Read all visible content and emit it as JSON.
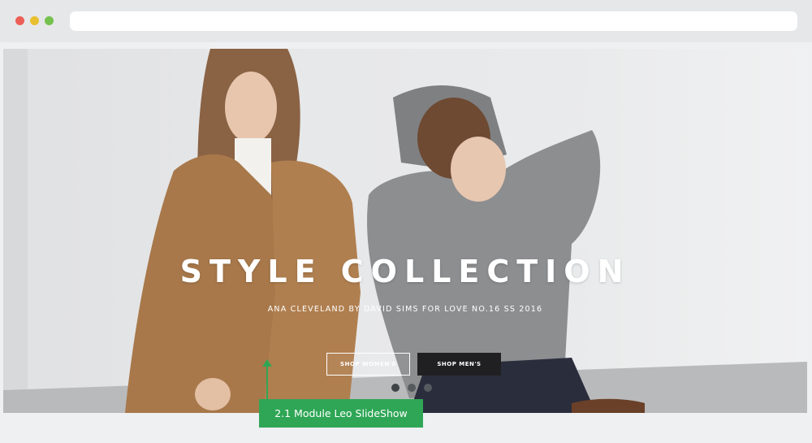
{
  "browser": {
    "window_controls": [
      "close-dot",
      "minimize-dot",
      "maximize-dot"
    ],
    "url": ""
  },
  "slideshow": {
    "headline": "STYLE COLLECTION",
    "subline": "ANA CLEVELAND BY DAVID SIMS FOR LOVE NO.16 SS 2016",
    "buttons": {
      "shop_women": "SHOP WOMEN'S",
      "shop_men": "SHOP MEN'S"
    },
    "pager": {
      "count": 3,
      "active": 1
    }
  },
  "annotation": {
    "label": "2.1 Module Leo SlideShow"
  },
  "colors": {
    "accent_green": "#2fa656",
    "button_dark": "#202022",
    "close": "#ec5f57",
    "minimize": "#e8bf30",
    "maximize": "#74c24d"
  }
}
